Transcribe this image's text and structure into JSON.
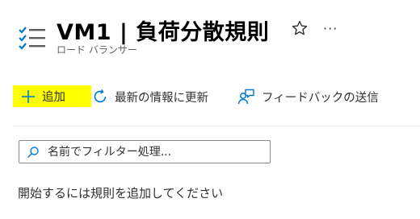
{
  "header": {
    "title": "VM1 | 負荷分散規則",
    "subtitle": "ロード バランサー",
    "more_label": "···"
  },
  "toolbar": {
    "add_label": "追加",
    "refresh_label": "最新の情報に更新",
    "feedback_label": "フィードバックの送信"
  },
  "search": {
    "placeholder": "名前でフィルター処理..."
  },
  "main": {
    "empty_message": "開始するには規則を追加してください"
  },
  "colors": {
    "accent": "#0078d4",
    "add_highlight": "#ffff00"
  }
}
